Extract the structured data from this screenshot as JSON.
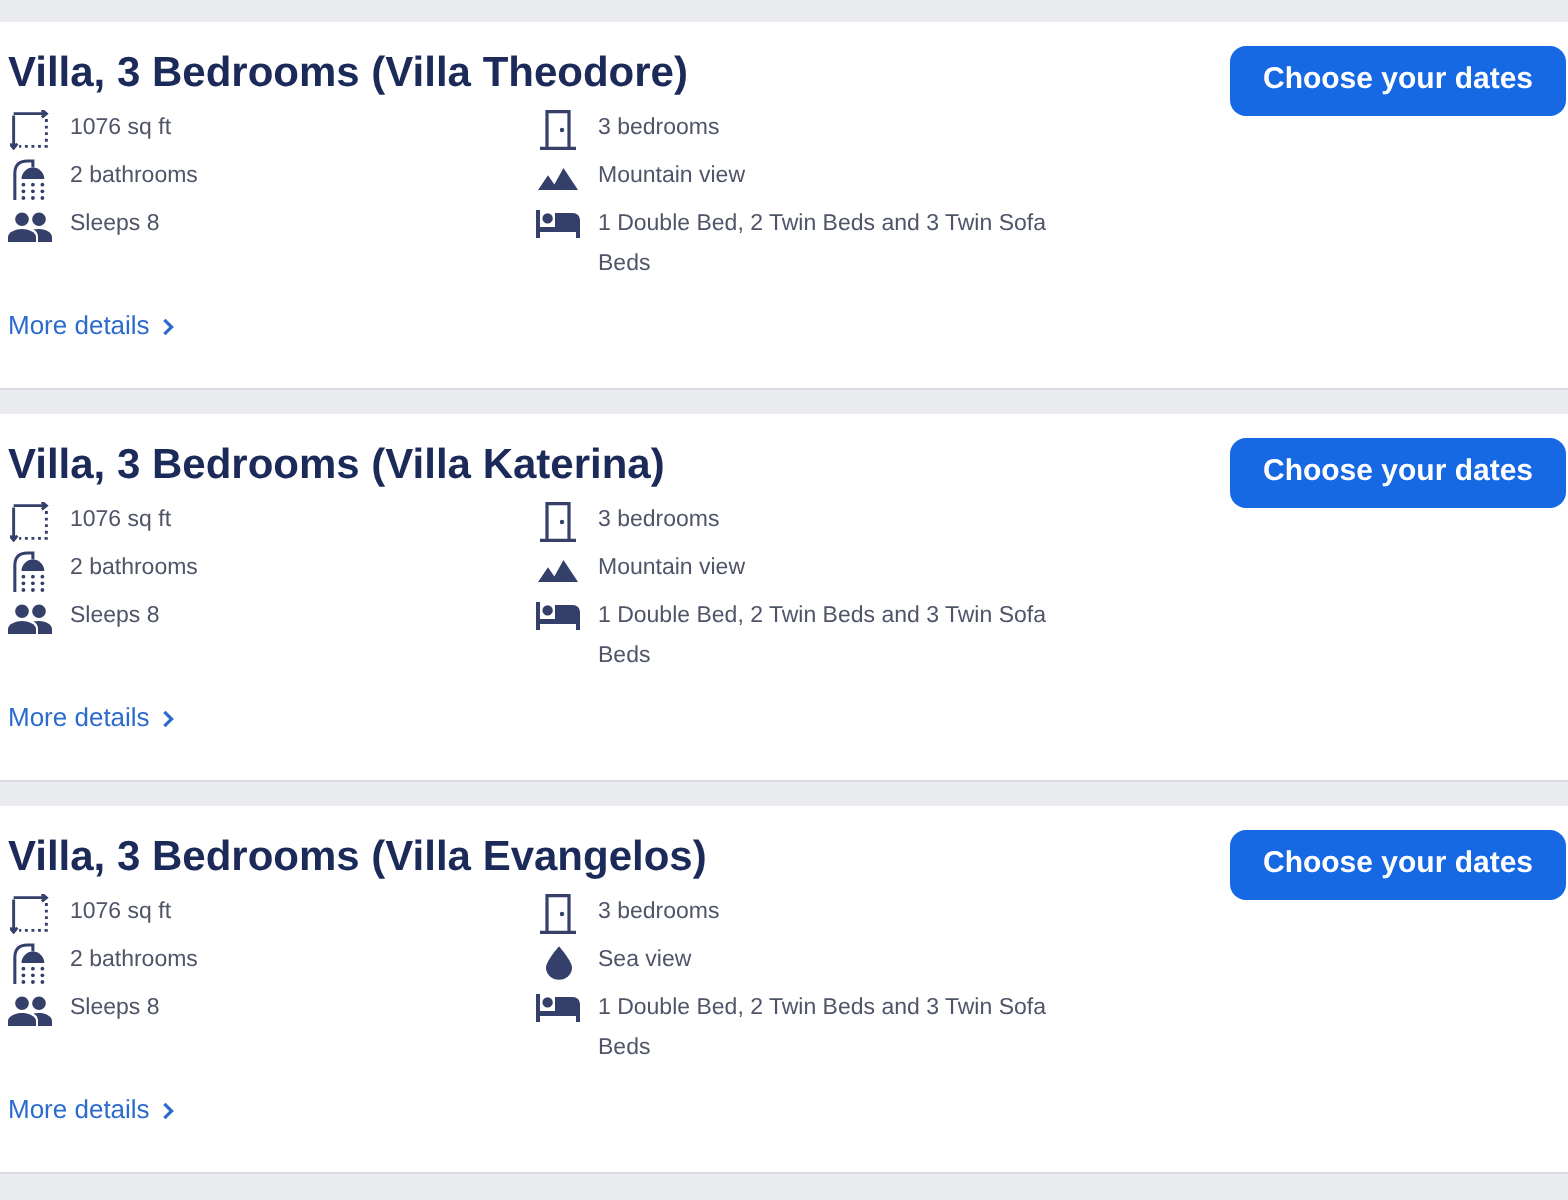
{
  "listings": [
    {
      "title": "Villa, 3 Bedrooms (Villa Theodore)",
      "button": "Choose your dates",
      "left_features": [
        {
          "kind": "area",
          "text": "1076 sq ft"
        },
        {
          "kind": "bathrooms",
          "text": "2 bathrooms"
        },
        {
          "kind": "sleeps",
          "text": "Sleeps 8"
        }
      ],
      "right_features": [
        {
          "kind": "bedrooms",
          "text": "3 bedrooms"
        },
        {
          "kind": "mountain_view",
          "text": "Mountain view"
        },
        {
          "kind": "beds",
          "text": "1 Double Bed, 2 Twin Beds and 3 Twin Sofa Beds"
        }
      ],
      "link": "More details"
    },
    {
      "title": "Villa, 3 Bedrooms (Villa Katerina)",
      "button": "Choose your dates",
      "left_features": [
        {
          "kind": "area",
          "text": "1076 sq ft"
        },
        {
          "kind": "bathrooms",
          "text": "2 bathrooms"
        },
        {
          "kind": "sleeps",
          "text": "Sleeps 8"
        }
      ],
      "right_features": [
        {
          "kind": "bedrooms",
          "text": "3 bedrooms"
        },
        {
          "kind": "mountain_view",
          "text": "Mountain view"
        },
        {
          "kind": "beds",
          "text": "1 Double Bed, 2 Twin Beds and 3 Twin Sofa Beds"
        }
      ],
      "link": "More details"
    },
    {
      "title": "Villa, 3 Bedrooms (Villa Evangelos)",
      "button": "Choose your dates",
      "left_features": [
        {
          "kind": "area",
          "text": "1076 sq ft"
        },
        {
          "kind": "bathrooms",
          "text": "2 bathrooms"
        },
        {
          "kind": "sleeps",
          "text": "Sleeps 8"
        }
      ],
      "right_features": [
        {
          "kind": "bedrooms",
          "text": "3 bedrooms"
        },
        {
          "kind": "sea_view",
          "text": "Sea view"
        },
        {
          "kind": "beds",
          "text": "1 Double Bed, 2 Twin Beds and 3 Twin Sofa Beds"
        }
      ],
      "link": "More details"
    }
  ]
}
